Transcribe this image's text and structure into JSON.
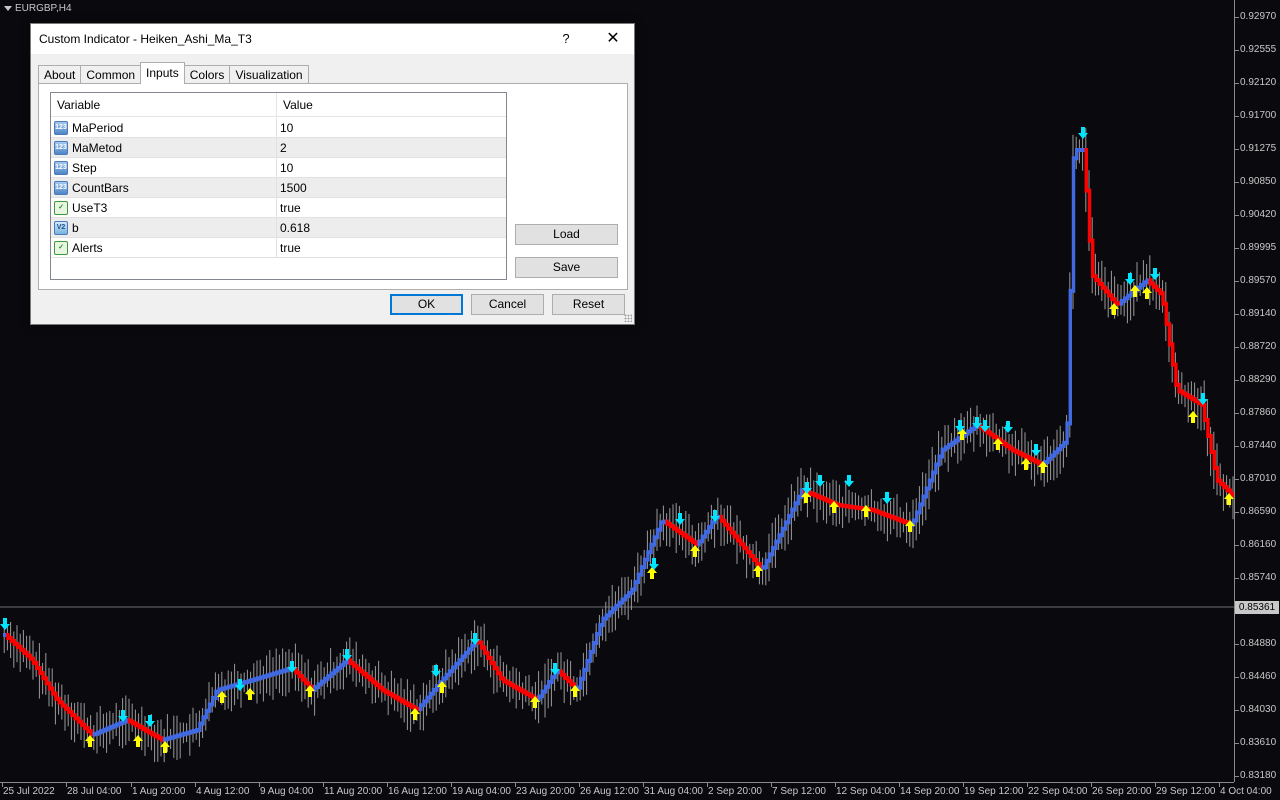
{
  "chart": {
    "symbol": "EURGBP,H4",
    "current_price": "0.85361",
    "price_labels": [
      "0.92970",
      "0.92555",
      "0.92120",
      "0.91700",
      "0.91275",
      "0.90850",
      "0.90420",
      "0.89995",
      "0.89570",
      "0.89140",
      "0.88720",
      "0.88290",
      "0.87860",
      "0.87440",
      "0.87010",
      "0.86590",
      "0.86160",
      "0.85740",
      "0.84880",
      "0.84460",
      "0.84030",
      "0.83610",
      "0.83180"
    ],
    "time_labels": [
      "25 Jul 2022",
      "28 Jul 04:00",
      "1 Aug 20:00",
      "4 Aug 12:00",
      "9 Aug 04:00",
      "11 Aug 20:00",
      "16 Aug 12:00",
      "19 Aug 04:00",
      "23 Aug 20:00",
      "26 Aug 12:00",
      "31 Aug 04:00",
      "2 Sep 20:00",
      "7 Sep 12:00",
      "12 Sep 04:00",
      "14 Sep 20:00",
      "19 Sep 12:00",
      "22 Sep 04:00",
      "26 Sep 20:00",
      "29 Sep 12:00",
      "4 Oct 04:00"
    ],
    "colors": {
      "up": "#4169e1",
      "down": "#ff0000",
      "wick": "#9a9a9a",
      "buy_arrow": "#ffff00",
      "sell_arrow": "#00e5ff",
      "background": "#0a0a0e"
    }
  },
  "dialog": {
    "title": "Custom Indicator - Heiken_Ashi_Ma_T3",
    "help": "?",
    "close": "✕",
    "tabs": [
      "About",
      "Common",
      "Inputs",
      "Colors",
      "Visualization"
    ],
    "active_tab": "Inputs",
    "grid": {
      "headers": [
        "Variable",
        "Value"
      ],
      "rows": [
        {
          "type": "int",
          "icon": "123",
          "variable": "MaPeriod",
          "value": "10"
        },
        {
          "type": "int",
          "icon": "123",
          "variable": "MaMetod",
          "value": "2"
        },
        {
          "type": "int",
          "icon": "123",
          "variable": "Step",
          "value": "10"
        },
        {
          "type": "int",
          "icon": "123",
          "variable": "CountBars",
          "value": "1500"
        },
        {
          "type": "bool",
          "icon": "✓",
          "variable": "UseT3",
          "value": "true"
        },
        {
          "type": "dbl",
          "icon": "V2",
          "variable": "b",
          "value": "0.618"
        },
        {
          "type": "bool",
          "icon": "✓",
          "variable": "Alerts",
          "value": "true"
        }
      ]
    },
    "buttons": {
      "load": "Load",
      "save": "Save",
      "ok": "OK",
      "cancel": "Cancel",
      "reset": "Reset"
    }
  }
}
